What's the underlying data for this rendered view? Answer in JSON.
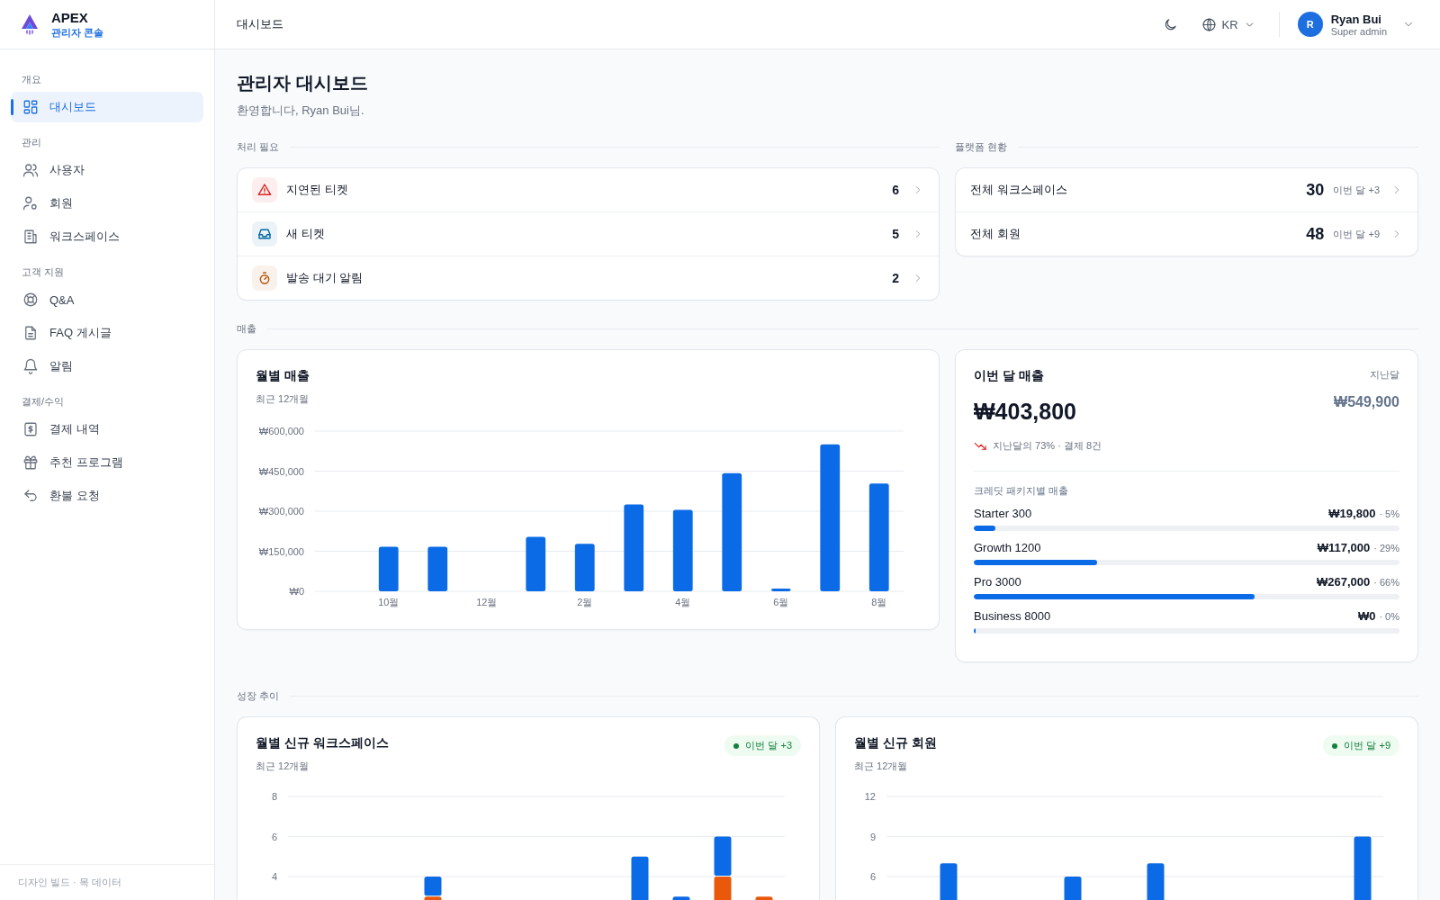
{
  "brand": {
    "name": "APEX",
    "subtitle": "관리자 콘솔"
  },
  "sidebar": {
    "sections": [
      {
        "title": "개요",
        "items": [
          {
            "label": "대시보드",
            "selected": true
          }
        ]
      },
      {
        "title": "관리",
        "items": [
          {
            "label": "사용자",
            "selected": false
          },
          {
            "label": "회원",
            "selected": false
          },
          {
            "label": "워크스페이스",
            "selected": false
          }
        ]
      },
      {
        "title": "고객 지원",
        "items": [
          {
            "label": "Q&A",
            "selected": false
          },
          {
            "label": "FAQ 게시글",
            "selected": false
          },
          {
            "label": "알림",
            "selected": false
          }
        ]
      },
      {
        "title": "결제/수익",
        "items": [
          {
            "label": "결제 내역",
            "selected": false
          },
          {
            "label": "추천 프로그램",
            "selected": false
          },
          {
            "label": "환불 요청",
            "selected": false
          }
        ]
      }
    ],
    "footer": "디자인 빌드 · 목 데이터"
  },
  "header": {
    "title": "대시보드",
    "language": "KR",
    "user": {
      "initial": "R",
      "name": "Ryan Bui",
      "role": "Super admin"
    }
  },
  "page": {
    "title": "관리자 대시보드",
    "greeting": "환영합니다, Ryan Bui님."
  },
  "action_required": {
    "heading": "처리 필요",
    "items": [
      {
        "label": "지연된 티켓",
        "count": "6",
        "color": "#dc2626"
      },
      {
        "label": "새 티켓",
        "count": "5",
        "color": "#0369a1"
      },
      {
        "label": "발송 대기 알림",
        "count": "2",
        "color": "#b45309"
      }
    ]
  },
  "platform": {
    "heading": "플랫폼 현황",
    "items": [
      {
        "label": "전체 워크스페이스",
        "value": "30",
        "delta": "이번 달 +3"
      },
      {
        "label": "전체 회원",
        "value": "48",
        "delta": "이번 달 +9"
      }
    ]
  },
  "revenue": {
    "heading": "매출",
    "monthly": {
      "title": "월별 매출",
      "subtitle": "최근 12개월",
      "chart_data": {
        "type": "bar",
        "categories": [
          null,
          "10월",
          null,
          "12월",
          null,
          "2월",
          null,
          "4월",
          null,
          "6월",
          null,
          "8월"
        ],
        "grid": true,
        "series": [
          {
            "color": "#0b6be6",
            "values": [
              0,
              167000,
              167000,
              0,
              204000,
              178000,
              325000,
              305000,
              442000,
              10000,
              549900,
              403800
            ]
          }
        ],
        "ylim": [
          0,
          600000
        ],
        "yticks": [
          {
            "value": 0,
            "label": "₩0"
          },
          {
            "value": 150000,
            "label": "₩150,000"
          },
          {
            "value": 300000,
            "label": "₩300,000"
          },
          {
            "value": 450000,
            "label": "₩450,000"
          },
          {
            "value": 600000,
            "label": "₩600,000"
          }
        ]
      }
    },
    "this_month": {
      "title": "이번 달 매출",
      "amount": "₩403,800",
      "previous_label": "지난달",
      "previous_amount": "₩549,900",
      "trend": "지난달의 73% · 결제 8건",
      "packages_title": "크레딧 패키지별 매출",
      "packages": [
        {
          "name": "Starter 300",
          "amount": "₩19,800",
          "share": "· 5%",
          "level": 0.05
        },
        {
          "name": "Growth 1200",
          "amount": "₩117,000",
          "share": "· 29%",
          "level": 0.29
        },
        {
          "name": "Pro 3000",
          "amount": "₩267,000",
          "share": "· 66%",
          "level": 0.66
        },
        {
          "name": "Business 8000",
          "amount": "₩0",
          "share": "· 0%",
          "level": 0
        }
      ]
    }
  },
  "growth": {
    "heading": "성장 추이",
    "charts": [
      {
        "title": "월별 신규 워크스페이스",
        "subtitle": "최근 12개월",
        "badge": "이번 달 +3",
        "axis_labels": [
          "8",
          "6",
          "4"
        ]
      },
      {
        "title": "월별 신규 회원",
        "subtitle": "최근 12개월",
        "badge": "이번 달 +9",
        "axis_labels": [
          "12",
          "9",
          "6"
        ]
      }
    ]
  }
}
